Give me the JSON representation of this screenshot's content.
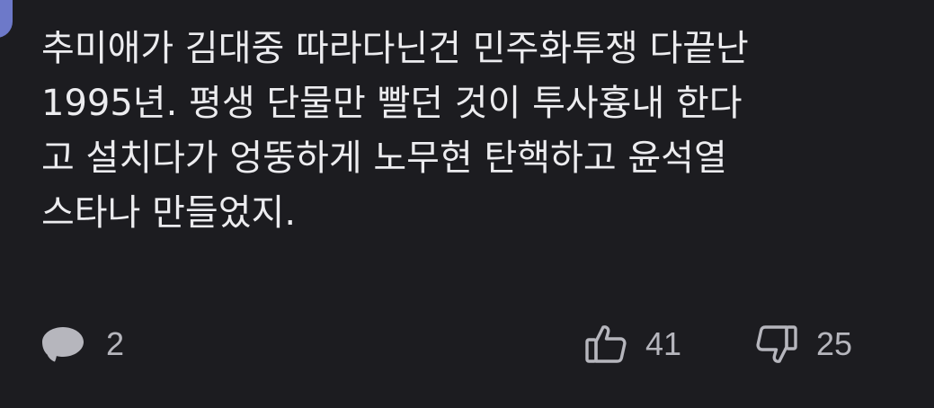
{
  "colors": {
    "background": "#1c1c20",
    "text": "#ececef",
    "muted": "#b6b6bd",
    "avatar": "#6d79c9"
  },
  "comment": {
    "lines": [
      "추미애가 김대중 따라다닌건 민주화투쟁 다끝난",
      "1995년. 평생 단물만 빨던 것이 투사흉내 한다",
      "고 설치다가 엉뚱하게 노무현 탄핵하고 윤석열",
      "스타나 만들었지."
    ]
  },
  "actions": {
    "reply": {
      "icon": "speech-bubble-icon",
      "count": "2"
    },
    "like": {
      "icon": "thumbs-up-icon",
      "count": "41"
    },
    "dislike": {
      "icon": "thumbs-down-icon",
      "count": "25"
    }
  }
}
